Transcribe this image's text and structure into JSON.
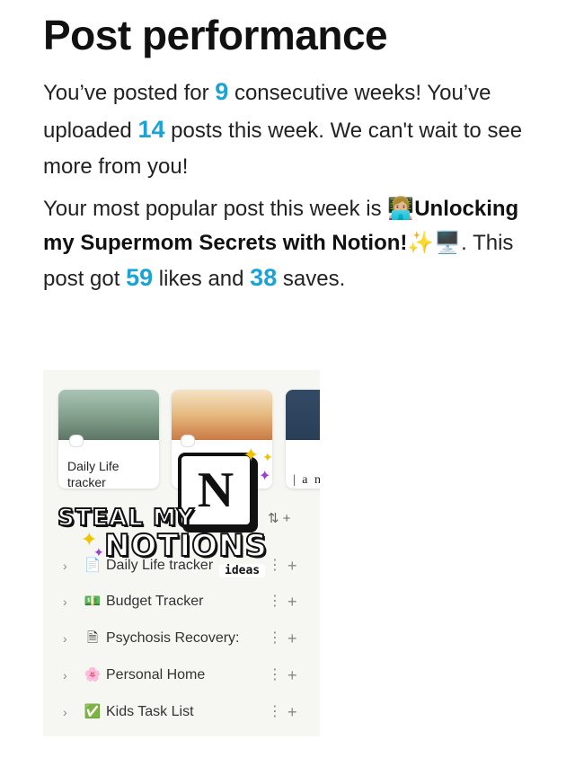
{
  "page": {
    "title": "Post performance"
  },
  "streak": {
    "text1": "You’ve posted for ",
    "weeks": "9",
    "text2": " consecutive weeks! You’ve uploaded ",
    "posts": "14",
    "text3": " posts this week. We can't wait to see more from you!"
  },
  "popular": {
    "intro": "Your most popular post this week is ",
    "post_title": "👩🏼‍💻Unlocking my Supermom Secrets with Notion!✨🖥️",
    "text1": ". This post got ",
    "likes": "59",
    "text2": " likes and ",
    "saves": "38",
    "text3": " saves."
  },
  "preview": {
    "cards": [
      {
        "label": "Daily Life tracker"
      },
      {
        "label": ""
      },
      {
        "label": "| a n"
      }
    ],
    "logo_letter": "N",
    "sticker_line1": "STEAL MY",
    "sticker_line2": "NOTIONS",
    "sticker_tag": "ideas",
    "sort_icon": "⇅",
    "add_symbol": "+",
    "rows": [
      {
        "icon": "page-icon",
        "glyph": "📄",
        "label": "Daily Life tracker"
      },
      {
        "icon": "money-icon",
        "glyph": "💵",
        "label": "Budget Tracker"
      },
      {
        "icon": "document-icon",
        "glyph": "🗎",
        "label": "Psychosis Recovery:"
      },
      {
        "icon": "flower-icon",
        "glyph": "🌸",
        "label": "Personal Home"
      },
      {
        "icon": "checkmark-icon",
        "glyph": "✅",
        "label": "Kids Task List"
      }
    ],
    "row_chevron": "›",
    "row_menu": "⋮"
  }
}
